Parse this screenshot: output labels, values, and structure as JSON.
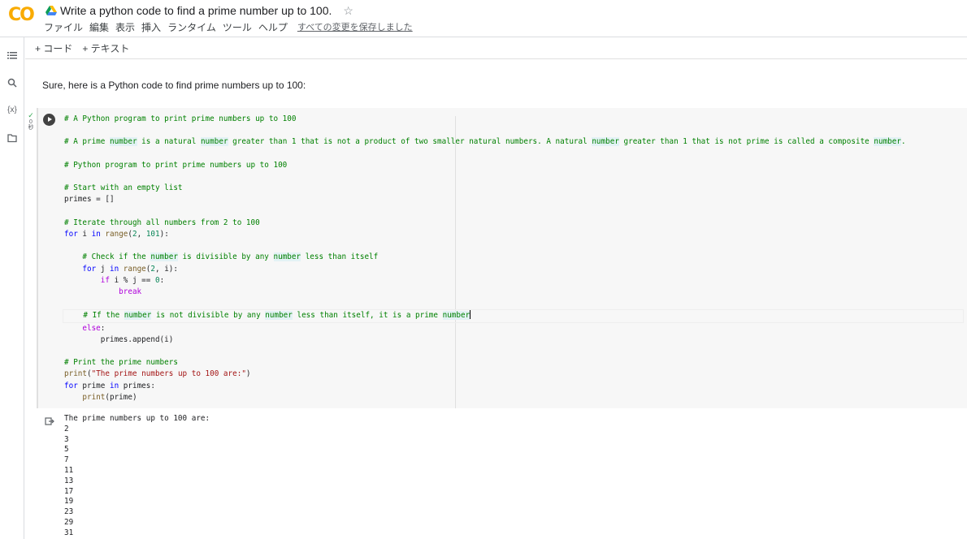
{
  "header": {
    "logo": "CO",
    "title": "Write a python code to find a prime number up to 100.",
    "menu": [
      "ファイル",
      "編集",
      "表示",
      "挿入",
      "ランタイム",
      "ツール",
      "ヘルプ"
    ],
    "saved_status": "すべての変更を保存しました"
  },
  "toolbar": {
    "add_code": "+ コード",
    "add_text": "+ テキスト"
  },
  "sidebar": {
    "icons": [
      "toc-icon",
      "search-icon",
      "variables-icon",
      "files-icon"
    ],
    "variables_label": "{x}"
  },
  "text_cell": "Sure, here is a Python code to find prime numbers up to 100:",
  "code_cell": {
    "exec_time": "0\n秒",
    "lines": [
      "# A Python program to print prime numbers up to 100",
      "",
      "# A prime number is a natural number greater than 1 that is not a product of two smaller natural numbers. A natural number greater than 1 that is not prime is called a composite number.",
      "",
      "# Python program to print prime numbers up to 100",
      "",
      "# Start with an empty list",
      "primes = []",
      "",
      "# Iterate through all numbers from 2 to 100",
      "for i in range(2, 101):",
      "",
      "    # Check if the number is divisible by any number less than itself",
      "    for j in range(2, i):",
      "        if i % j == 0:",
      "            break",
      "",
      "    # If the number is not divisible by any number less than itself, it is a prime number",
      "    else:",
      "        primes.append(i)",
      "",
      "# Print the prime numbers",
      "print(\"The prime numbers up to 100 are:\")",
      "for prime in primes:",
      "    print(prime)"
    ]
  },
  "output": {
    "lines": [
      "The prime numbers up to 100 are:",
      "2",
      "3",
      "5",
      "7",
      "11",
      "13",
      "17",
      "19",
      "23",
      "29",
      "31"
    ]
  },
  "colors": {
    "comment": "#008000",
    "keyword": "#0000ff",
    "control_keyword": "#af00db",
    "number": "#098658",
    "string": "#a31515",
    "logo_yellow": "#f9ab00",
    "logo_orange": "#e8710a"
  }
}
